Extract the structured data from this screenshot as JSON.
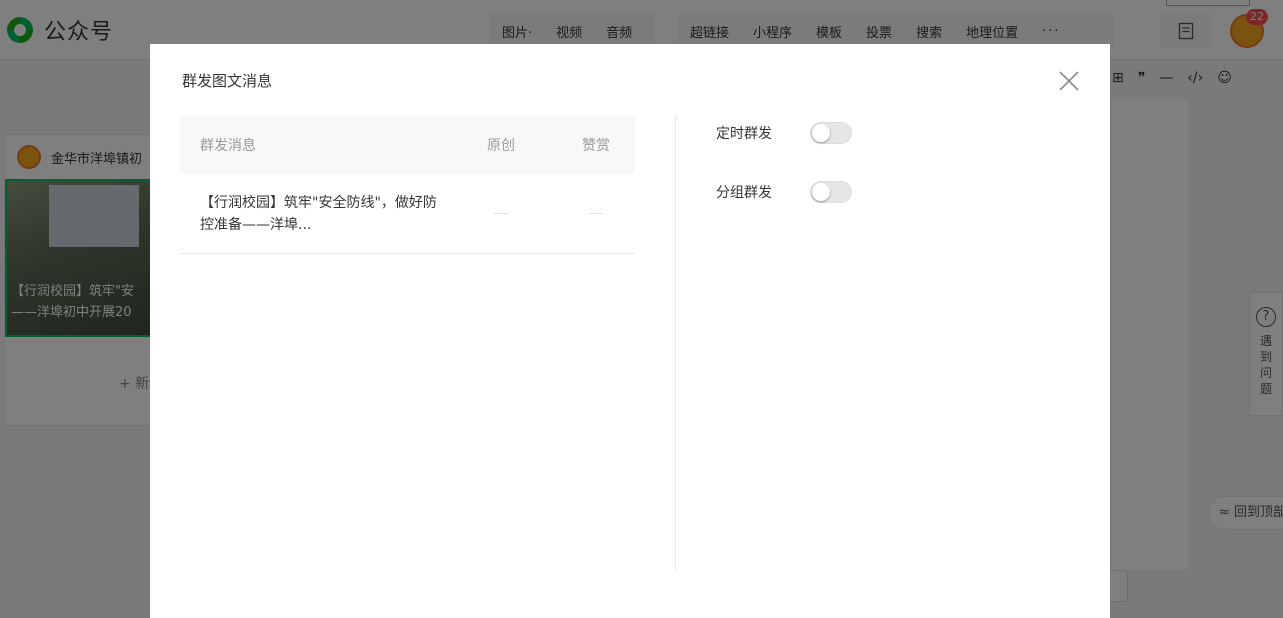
{
  "header": {
    "logo_text": "公众号",
    "toolbar_group1": [
      "图片·",
      "视频",
      "音频"
    ],
    "toolbar_group2": [
      "超链接",
      "小程序",
      "模板",
      "投票",
      "搜索",
      "地理位置",
      "···"
    ],
    "notification_count": "22"
  },
  "editor_toolbar2": [
    "⊞",
    "❞",
    "—",
    "‹/›",
    "☺"
  ],
  "sidebar_card": {
    "account_name": "金华市洋埠镇初",
    "article_caption_line1": "【行润校园】筑牢\"安",
    "article_caption_line2": "——洋埠初中开展20",
    "add_label": "+ 新"
  },
  "help": {
    "icon": "?",
    "label": "遇到问题"
  },
  "back_to_top": "≈ 回到顶部",
  "dialog": {
    "title": "群发图文消息",
    "table": {
      "headers": [
        "群发消息",
        "原创",
        "赞赏"
      ],
      "rows": [
        {
          "message": "【行润校园】筑牢\"安全防线\"，做好防控准备——洋埠..."
        }
      ]
    },
    "options": [
      {
        "label": "定时群发",
        "enabled": false
      },
      {
        "label": "分组群发",
        "enabled": false
      }
    ]
  }
}
